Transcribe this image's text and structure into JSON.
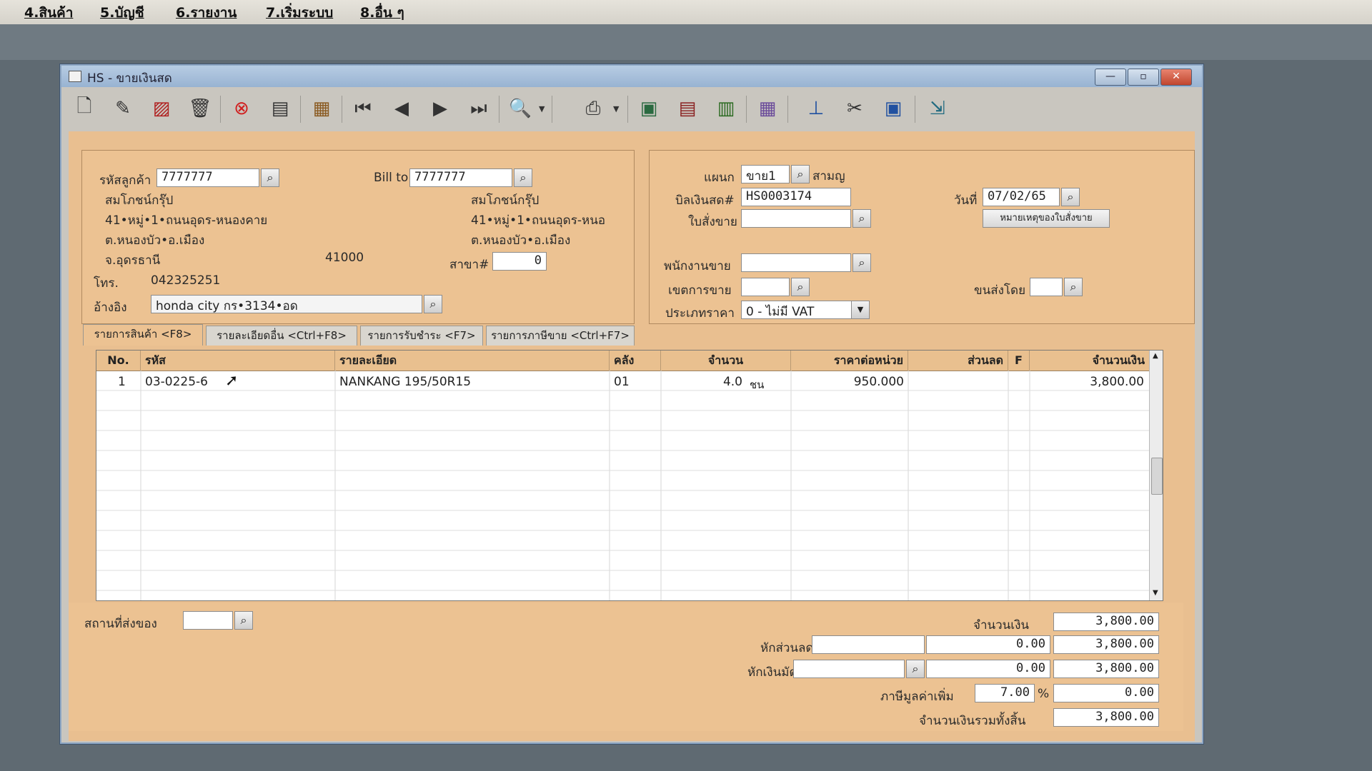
{
  "menu": [
    "4.สินค้า",
    "5.บัญชี",
    "6.รายงาน",
    "7.เริ่มระบบ",
    "8.อื่น ๆ"
  ],
  "window": {
    "title": "HS - ขายเงินสด"
  },
  "customer": {
    "code_label": "รหัสลูกค้า",
    "code": "7777777",
    "name": "สมโภชน์กรุ๊ป",
    "address1": "41•หมู่•1•ถนนอุดร-หนองคาย",
    "address2": "ต.หนองบัว•อ.เมือง",
    "province": "จ.อุดรธานี",
    "postcode": "41000",
    "phone_label": "โทร.",
    "phone": "042325251",
    "branch_label": "สาขา#",
    "branch": "0",
    "ref_label": "อ้างอิง",
    "ref": "honda city กร•3134•อด"
  },
  "billto": {
    "label": "Bill to",
    "code": "7777777",
    "name": "สมโภชน์กรุ๊ป",
    "address1": "41•หมู่•1•ถนนอุดร-หนอ",
    "address2": "ต.หนองบัว•อ.เมือง"
  },
  "doc": {
    "dept_label": "แผนก",
    "dept": "ขาย1",
    "dept_name": "สามญ",
    "bill_label": "บิลเงินสด#",
    "bill_no": "HS0003174",
    "date_label": "วันที่",
    "date": "07/02/65",
    "so_label": "ใบสั่งขาย",
    "so_note_button": "หมายเหตุของใบสั่งขาย",
    "salesman_label": "พนักงานขาย",
    "area_label": "เขตการขาย",
    "ship_label": "ขนส่งโดย",
    "price_type_label": "ประเภทราคา",
    "price_type": "0 - ไม่มี VAT"
  },
  "tabs": [
    "รายการสินค้า <F8>",
    "รายละเอียดอื่น <Ctrl+F8>",
    "รายการรับชำระ <F7>",
    "รายการภาษีขาย <Ctrl+F7>"
  ],
  "table": {
    "headers": [
      "No.",
      "รหัส",
      "รายละเอียด",
      "คลัง",
      "จำนวน",
      "ราคาต่อหน่วย",
      "ส่วนลด",
      "F",
      "จำนวนเงิน"
    ],
    "rows": [
      {
        "no": "1",
        "code": "03-0225-6",
        "desc": "NANKANG 195/50R15",
        "wh": "01",
        "qty": "4.0",
        "unit": "ชน",
        "price": "950.000",
        "disc": "",
        "f": "",
        "amount": "3,800.00"
      }
    ]
  },
  "footer": {
    "ship_place_label": "สถานที่ส่งของ",
    "amount_label": "จำนวนเงิน",
    "amount": "3,800.00",
    "discount_label": "หักส่วนลด",
    "discount_value": "0.00",
    "after_discount": "3,800.00",
    "deposit_label": "หักเงินมัดจำ",
    "deposit_value": "0.00",
    "after_deposit": "3,800.00",
    "vat_label": "ภาษีมูลค่าเพิ่ม",
    "vat_rate": "7.00",
    "vat_pct": "%",
    "vat_amount": "0.00",
    "total_label": "จำนวนเงินรวมทั้งสิ้น",
    "total": "3,800.00"
  }
}
